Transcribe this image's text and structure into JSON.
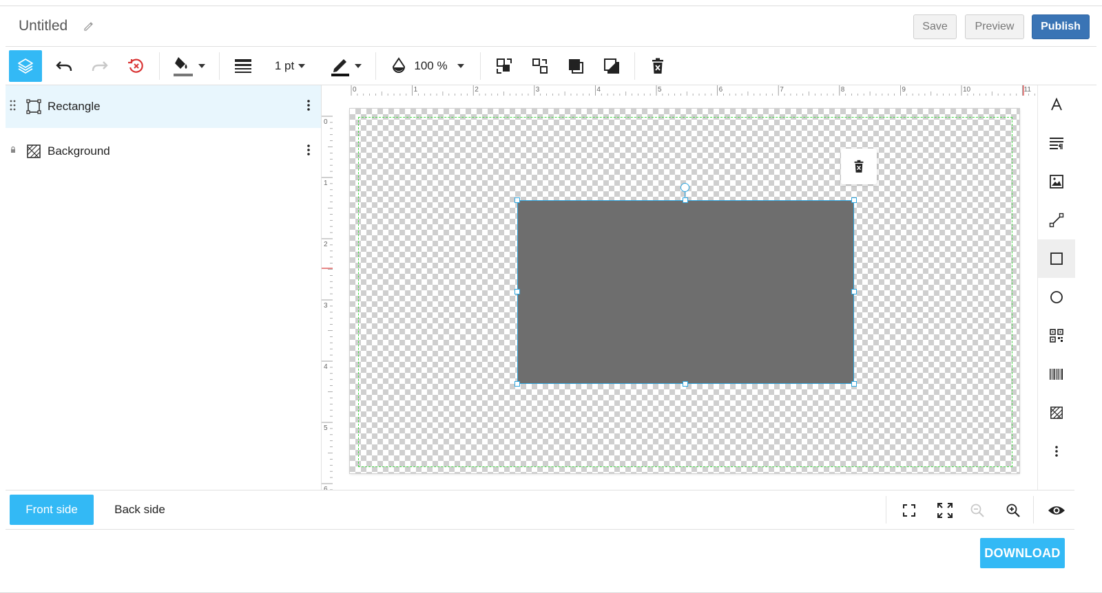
{
  "header": {
    "title": "Untitled",
    "save_label": "Save",
    "preview_label": "Preview",
    "publish_label": "Publish"
  },
  "toolbar": {
    "stroke_width": "1 pt",
    "opacity": "100 %"
  },
  "layers": [
    {
      "label": "Rectangle",
      "icon": "rectangle-icon",
      "selected": true,
      "locked": false
    },
    {
      "label": "Background",
      "icon": "background-icon",
      "selected": false,
      "locked": true
    }
  ],
  "rulers": {
    "horizontal_ticks": [
      "0",
      "1",
      "2",
      "3",
      "4",
      "5",
      "6",
      "7",
      "8",
      "9",
      "10",
      "11"
    ],
    "vertical_ticks": [
      "0",
      "1",
      "2",
      "3",
      "4",
      "5",
      "6"
    ]
  },
  "right_tools": [
    "text-icon",
    "paragraph-icon",
    "image-icon",
    "line-icon",
    "rectangle-icon",
    "circle-icon",
    "qr-code-icon",
    "barcode-icon",
    "background-icon",
    "more-icon"
  ],
  "bottom": {
    "front_label": "Front side",
    "back_label": "Back side"
  },
  "download_label": "DOWNLOAD",
  "colors": {
    "accent": "#33b9f5",
    "publish": "#3a74b5",
    "shape_fill": "#6e6e6e",
    "selection": "#2ca6e0",
    "safe_area": "#44d944",
    "undo_history": "#d93535"
  }
}
